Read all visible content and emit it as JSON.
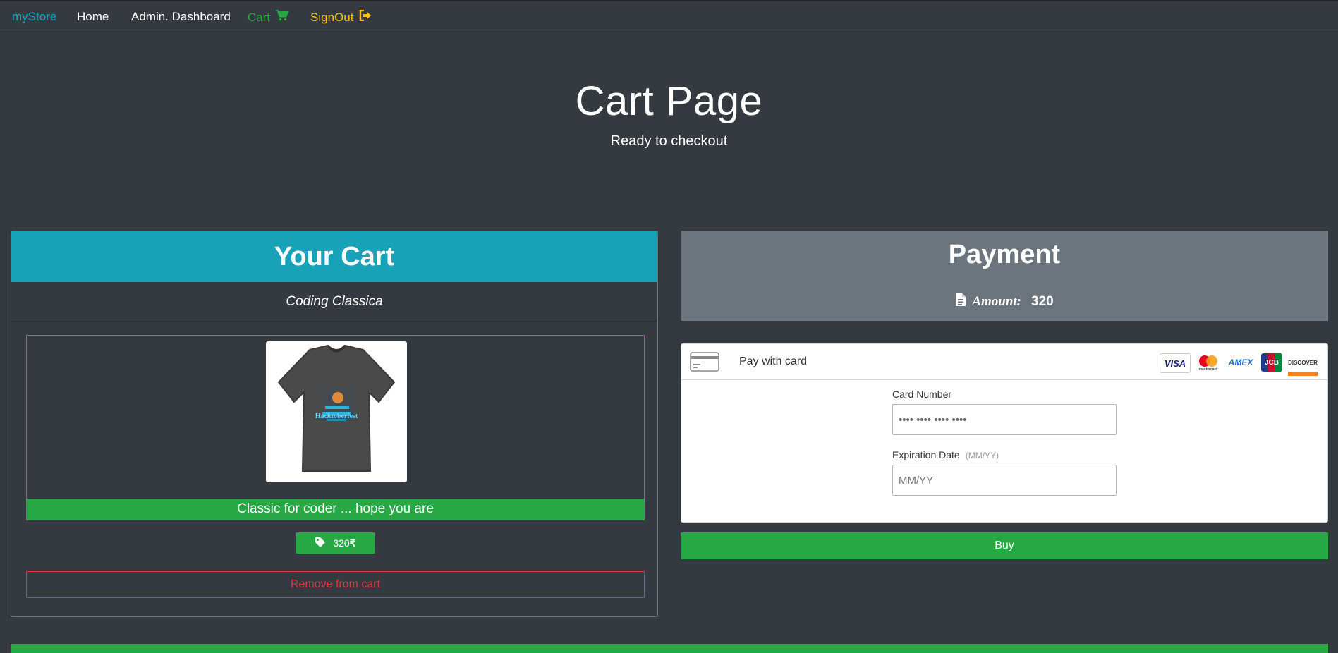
{
  "nav": {
    "brand": "myStore",
    "home": "Home",
    "admin": "Admin. Dashboard",
    "cart": "Cart",
    "signout": "SignOut",
    "cart_icon": "cart-icon",
    "signout_icon": "sign-out-icon"
  },
  "hero": {
    "title": "Cart Page",
    "subtitle": "Ready to checkout"
  },
  "cart": {
    "heading": "Your Cart",
    "product_name": "Coding Classica",
    "product_description": "Classic for coder ... hope you are",
    "price": "320",
    "currency_symbol": "₹",
    "remove_label": "Remove from cart",
    "image_text": "Hacktoberfest"
  },
  "payment": {
    "heading": "Payment",
    "amount_label": "Amount:",
    "amount_value": "320",
    "pay_with_card": "Pay with card",
    "card_number_label": "Card Number",
    "card_number_value": "•••• •••• •••• ••••",
    "expiration_label": "Expiration Date",
    "expiration_hint": "(MM/YY)",
    "expiration_placeholder": "MM/YY",
    "buy_label": "Buy",
    "card_brands": [
      "VISA",
      "mastercard",
      "AMEX",
      "JCB",
      "DISCOVER"
    ]
  },
  "colors": {
    "background": "#343a40",
    "info": "#17a2b8",
    "success": "#28a745",
    "danger": "#dc3545",
    "warning": "#ffc107",
    "secondary": "#6c757d"
  }
}
